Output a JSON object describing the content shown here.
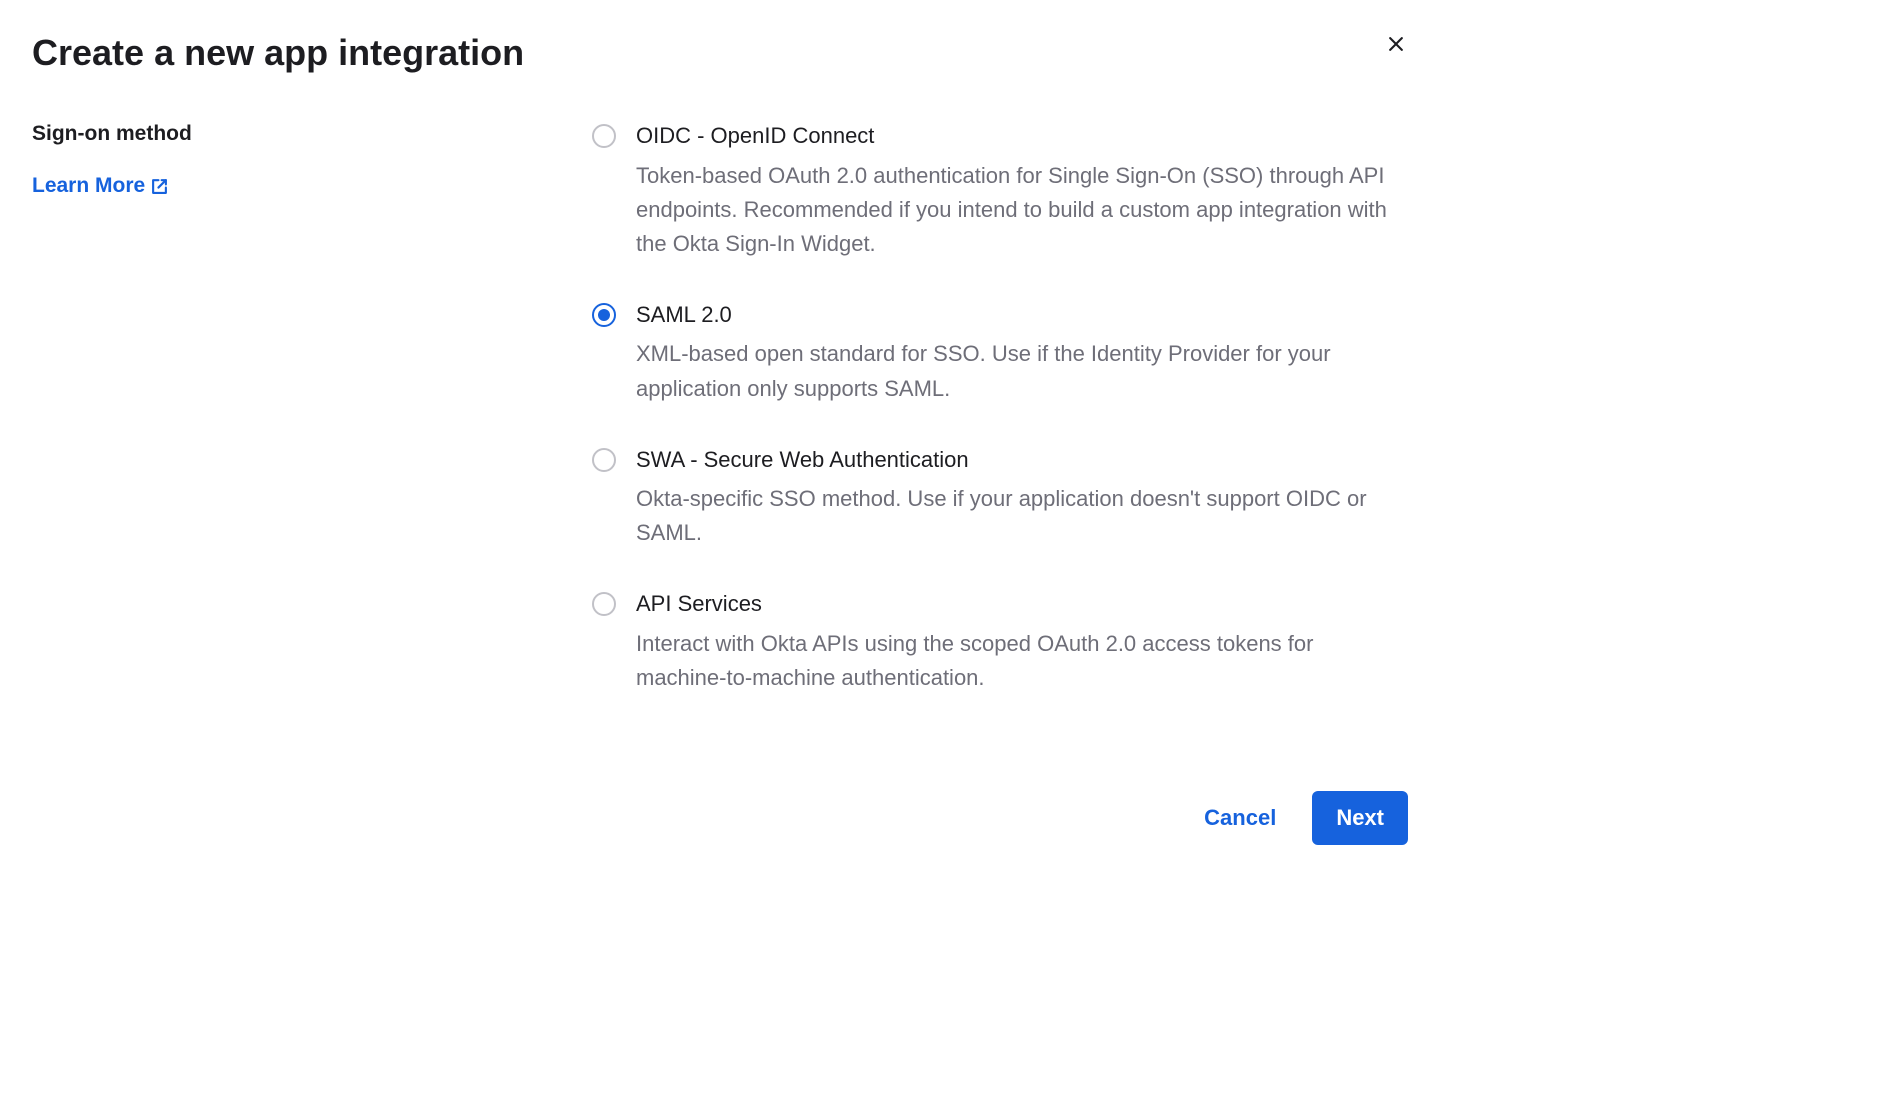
{
  "title": "Create a new app integration",
  "section_label": "Sign-on method",
  "learn_more_label": "Learn More",
  "options": [
    {
      "title": "OIDC - OpenID Connect",
      "description": "Token-based OAuth 2.0 authentication for Single Sign-On (SSO) through API endpoints. Recommended if you intend to build a custom app integration with the Okta Sign-In Widget.",
      "selected": false
    },
    {
      "title": "SAML 2.0",
      "description": "XML-based open standard for SSO. Use if the Identity Provider for your application only supports SAML.",
      "selected": true
    },
    {
      "title": "SWA - Secure Web Authentication",
      "description": "Okta-specific SSO method. Use if your application doesn't support OIDC or SAML.",
      "selected": false
    },
    {
      "title": "API Services",
      "description": "Interact with Okta APIs using the scoped OAuth 2.0 access tokens for machine-to-machine authentication.",
      "selected": false
    }
  ],
  "cancel_label": "Cancel",
  "next_label": "Next"
}
